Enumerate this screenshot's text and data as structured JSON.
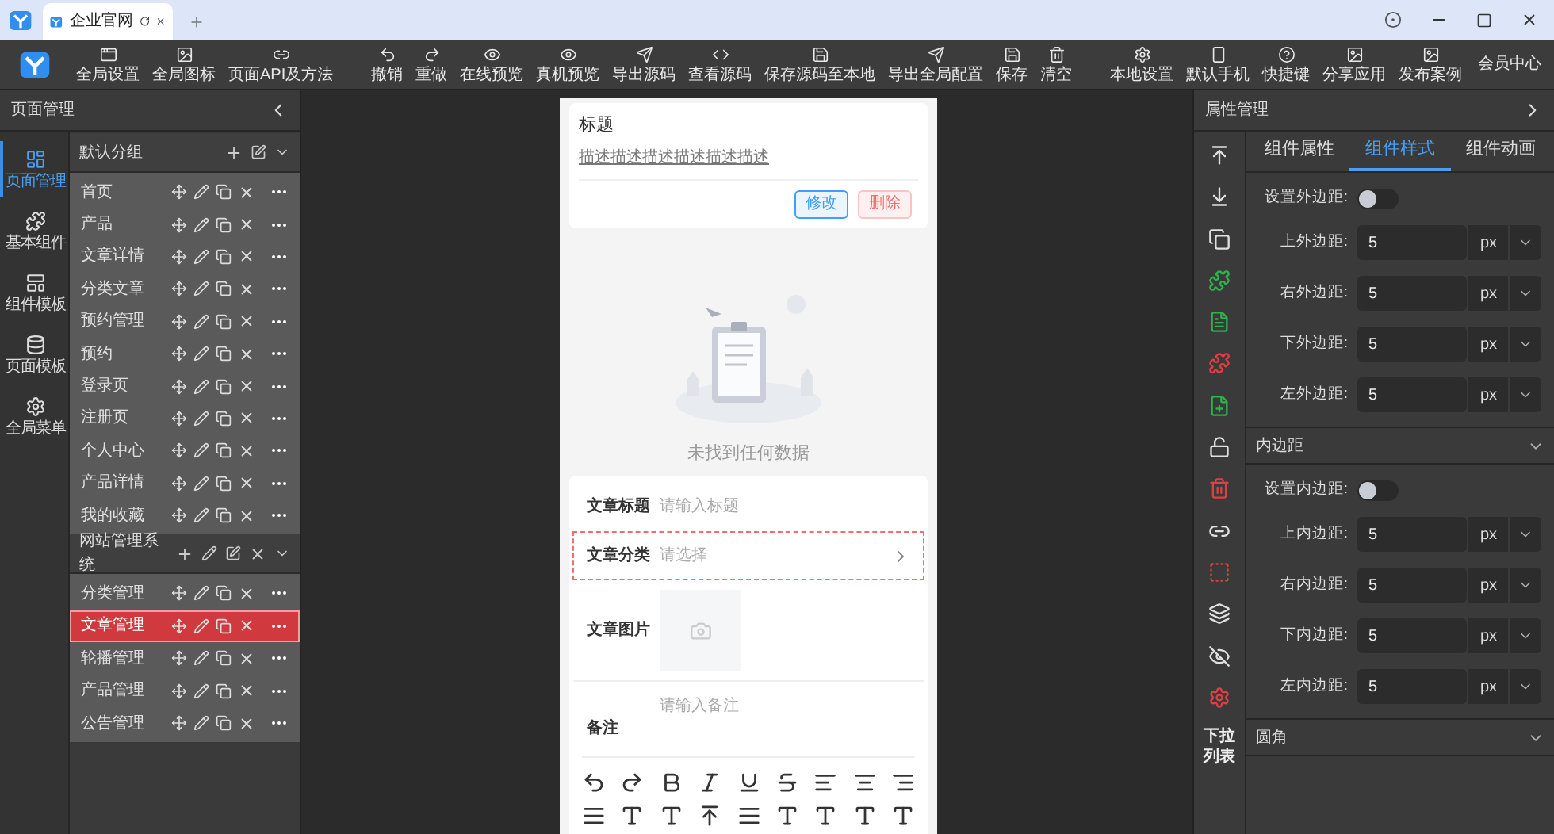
{
  "browser": {
    "tab_title": "企业官网"
  },
  "toolbar": {
    "left": [
      {
        "label": "全局设置"
      },
      {
        "label": "全局图标"
      },
      {
        "label": "页面API及方法"
      }
    ],
    "middle": [
      {
        "label": "撤销"
      },
      {
        "label": "重做"
      },
      {
        "label": "在线预览"
      },
      {
        "label": "真机预览"
      },
      {
        "label": "导出源码"
      },
      {
        "label": "查看源码"
      },
      {
        "label": "保存源码至本地"
      },
      {
        "label": "导出全局配置"
      },
      {
        "label": "保存"
      },
      {
        "label": "清空"
      }
    ],
    "right": [
      {
        "label": "本地设置",
        "kind": "icon"
      },
      {
        "label": "默认手机",
        "kind": "icon"
      },
      {
        "label": "快捷键",
        "kind": "icon"
      },
      {
        "label": "分享应用",
        "kind": "icon"
      },
      {
        "label": "发布案例",
        "kind": "icon"
      },
      {
        "label": "会员中心",
        "kind": "text"
      }
    ]
  },
  "left_panel": {
    "title": "页面管理",
    "rail": [
      {
        "label": "页面管理",
        "selected": true
      },
      {
        "label": "基本组件",
        "selected": false
      },
      {
        "label": "组件模板",
        "selected": false
      },
      {
        "label": "页面模板",
        "selected": false
      },
      {
        "label": "全局菜单",
        "selected": false
      }
    ],
    "groups": [
      {
        "name": "默认分组",
        "kind": "default",
        "pages": [
          {
            "name": "首页",
            "selected": false
          },
          {
            "name": "产品",
            "selected": false
          },
          {
            "name": "文章详情",
            "selected": false
          },
          {
            "name": "分类文章",
            "selected": false
          },
          {
            "name": "预约管理",
            "selected": false
          },
          {
            "name": "预约",
            "selected": false
          },
          {
            "name": "登录页",
            "selected": false
          },
          {
            "name": "注册页",
            "selected": false
          },
          {
            "name": "个人中心",
            "selected": false
          },
          {
            "name": "产品详情",
            "selected": false
          },
          {
            "name": "我的收藏",
            "selected": false
          }
        ]
      },
      {
        "name": "网站管理系统",
        "kind": "custom",
        "pages": [
          {
            "name": "分类管理",
            "selected": false
          },
          {
            "name": "文章管理",
            "selected": true
          },
          {
            "name": "轮播管理",
            "selected": false
          },
          {
            "name": "产品管理",
            "selected": false
          },
          {
            "name": "公告管理",
            "selected": false
          }
        ]
      }
    ]
  },
  "phone": {
    "card": {
      "title": "标题",
      "description": "描述描述描述描述描述描述",
      "buttons": [
        {
          "label": "修改",
          "kind": "primary"
        },
        {
          "label": "删除",
          "kind": "danger"
        }
      ]
    },
    "empty_text": "未找到任何数据",
    "form": [
      {
        "label": "文章标题",
        "placeholder": "请输入标题",
        "kind": "text",
        "selected": false
      },
      {
        "label": "文章分类",
        "placeholder": "请选择",
        "kind": "select",
        "selected": true
      },
      {
        "label": "文章图片",
        "kind": "image",
        "selected": false
      },
      {
        "label": "备注",
        "placeholder": "请输入备注",
        "kind": "textarea",
        "selected": false
      }
    ]
  },
  "right_panel": {
    "title": "属性管理",
    "rail_label": "下拉列表",
    "tabs": [
      {
        "label": "组件属性",
        "selected": false
      },
      {
        "label": "组件样式",
        "selected": true
      },
      {
        "label": "组件动画",
        "selected": false
      }
    ],
    "sections": [
      {
        "switch": {
          "label": "设置外边距:",
          "on": false
        },
        "fields": [
          {
            "label": "上外边距:",
            "value": "5",
            "unit": "px"
          },
          {
            "label": "右外边距:",
            "value": "5",
            "unit": "px"
          },
          {
            "label": "下外边距:",
            "value": "5",
            "unit": "px"
          },
          {
            "label": "左外边距:",
            "value": "5",
            "unit": "px"
          }
        ]
      },
      {
        "title": "内边距",
        "switch": {
          "label": "设置内边距:",
          "on": false
        },
        "fields": [
          {
            "label": "上内边距:",
            "value": "5",
            "unit": "px"
          },
          {
            "label": "右内边距:",
            "value": "5",
            "unit": "px"
          },
          {
            "label": "下内边距:",
            "value": "5",
            "unit": "px"
          },
          {
            "label": "左内边距:",
            "value": "5",
            "unit": "px"
          }
        ]
      },
      {
        "title": "圆角"
      }
    ]
  }
}
